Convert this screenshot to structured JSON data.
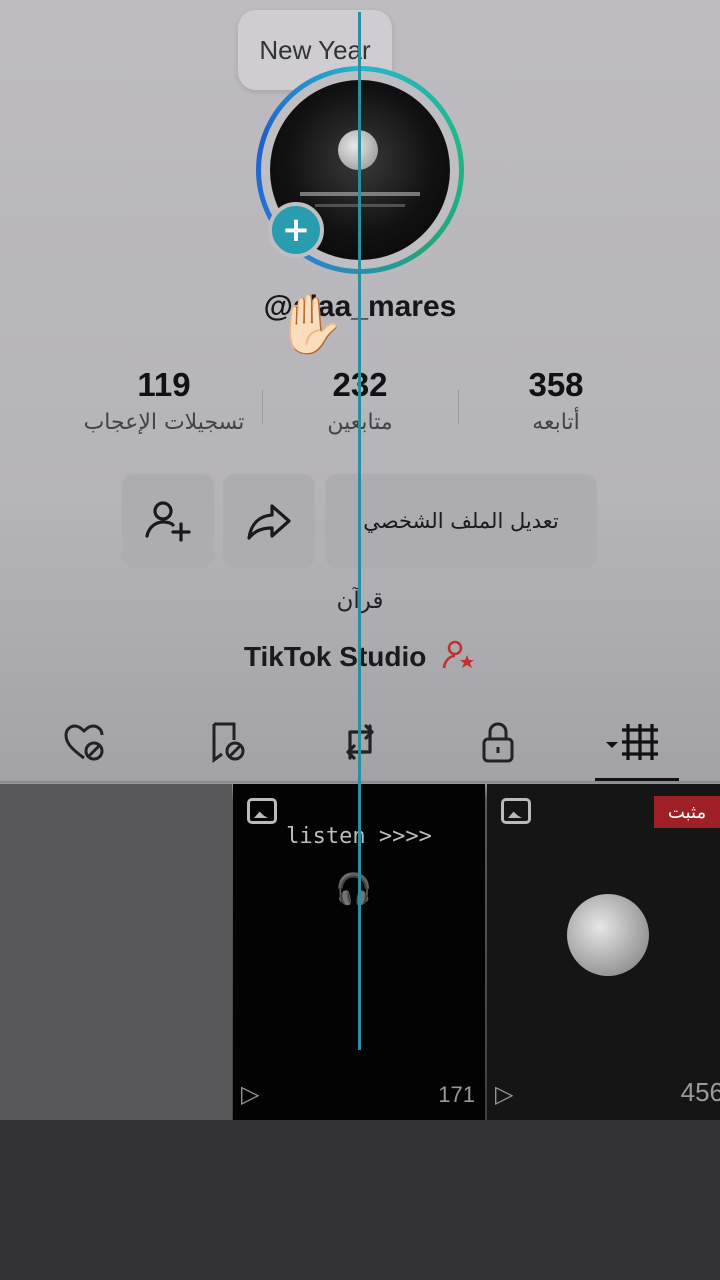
{
  "note": {
    "text": "New Year"
  },
  "profile": {
    "username": "@alaa_mares",
    "bio": "قرآن",
    "studio_label": "TikTok Studio"
  },
  "stats": [
    {
      "value": "358",
      "label": "أتابعه"
    },
    {
      "value": "232",
      "label": "متابعين"
    },
    {
      "value": "119",
      "label": "تسجيلات الإعجاب"
    }
  ],
  "buttons": {
    "edit_profile": "تعديل الملف الشخصي"
  },
  "icons": {
    "add": "plus-icon",
    "share": "share-arrow-icon",
    "add_friend": "person-plus-icon",
    "studio": "person-star-icon",
    "tabs": [
      "videos-grid-icon",
      "lock-icon",
      "repost-icon",
      "bookmark-hidden-icon",
      "liked-hidden-icon"
    ]
  },
  "videos": [
    {
      "title_text": "listen >>>>",
      "views": "171"
    },
    {
      "badge": "مثبت",
      "views": "456"
    }
  ],
  "colors": {
    "accent": "#2a9cb0",
    "pinned": "#9e1f25",
    "studio_icon": "#c0322d"
  }
}
